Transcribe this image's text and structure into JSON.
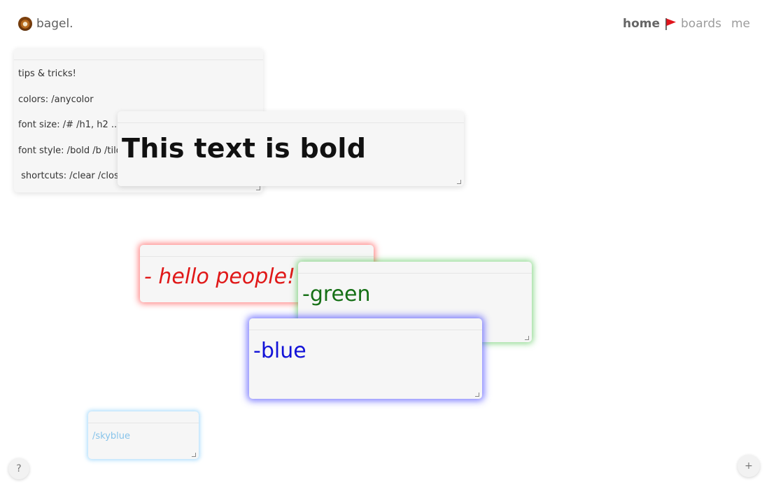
{
  "header": {
    "brand": "bagel.",
    "nav": {
      "home": "home",
      "boards": "boards",
      "me": "me"
    }
  },
  "notes": {
    "tips": {
      "lines": [
        "tips & tricks!",
        "colors: /anycolor",
        "font size: /# /h1, h2 ...",
        "font style: /bold /b /tilde",
        " shortcuts: /clear /close"
      ]
    },
    "bold": {
      "text": "This text is bold"
    },
    "red": {
      "text": "- hello people!",
      "color": "#e01818"
    },
    "green": {
      "text": "-green",
      "color": "#167016"
    },
    "blue": {
      "text": "-blue",
      "color": "#1212d8"
    },
    "sky": {
      "text": "/skyblue",
      "color": "#87c3ea"
    }
  },
  "controls": {
    "help": "?",
    "add": "+"
  },
  "icons": {
    "brand": "bagel-icon",
    "nav": "red-flag-icon"
  }
}
